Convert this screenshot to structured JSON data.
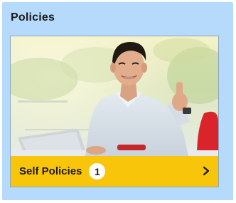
{
  "panel": {
    "title": "Policies"
  },
  "card": {
    "image_icon": "person-thumbs-up-photo",
    "footer_label": "Self Policies",
    "badge_count": "1",
    "chevron_icon": "chevron-right-icon"
  },
  "colors": {
    "panel_background": "#b6dafb",
    "footer_background": "#f9c50b",
    "badge_background": "#ffffff"
  }
}
